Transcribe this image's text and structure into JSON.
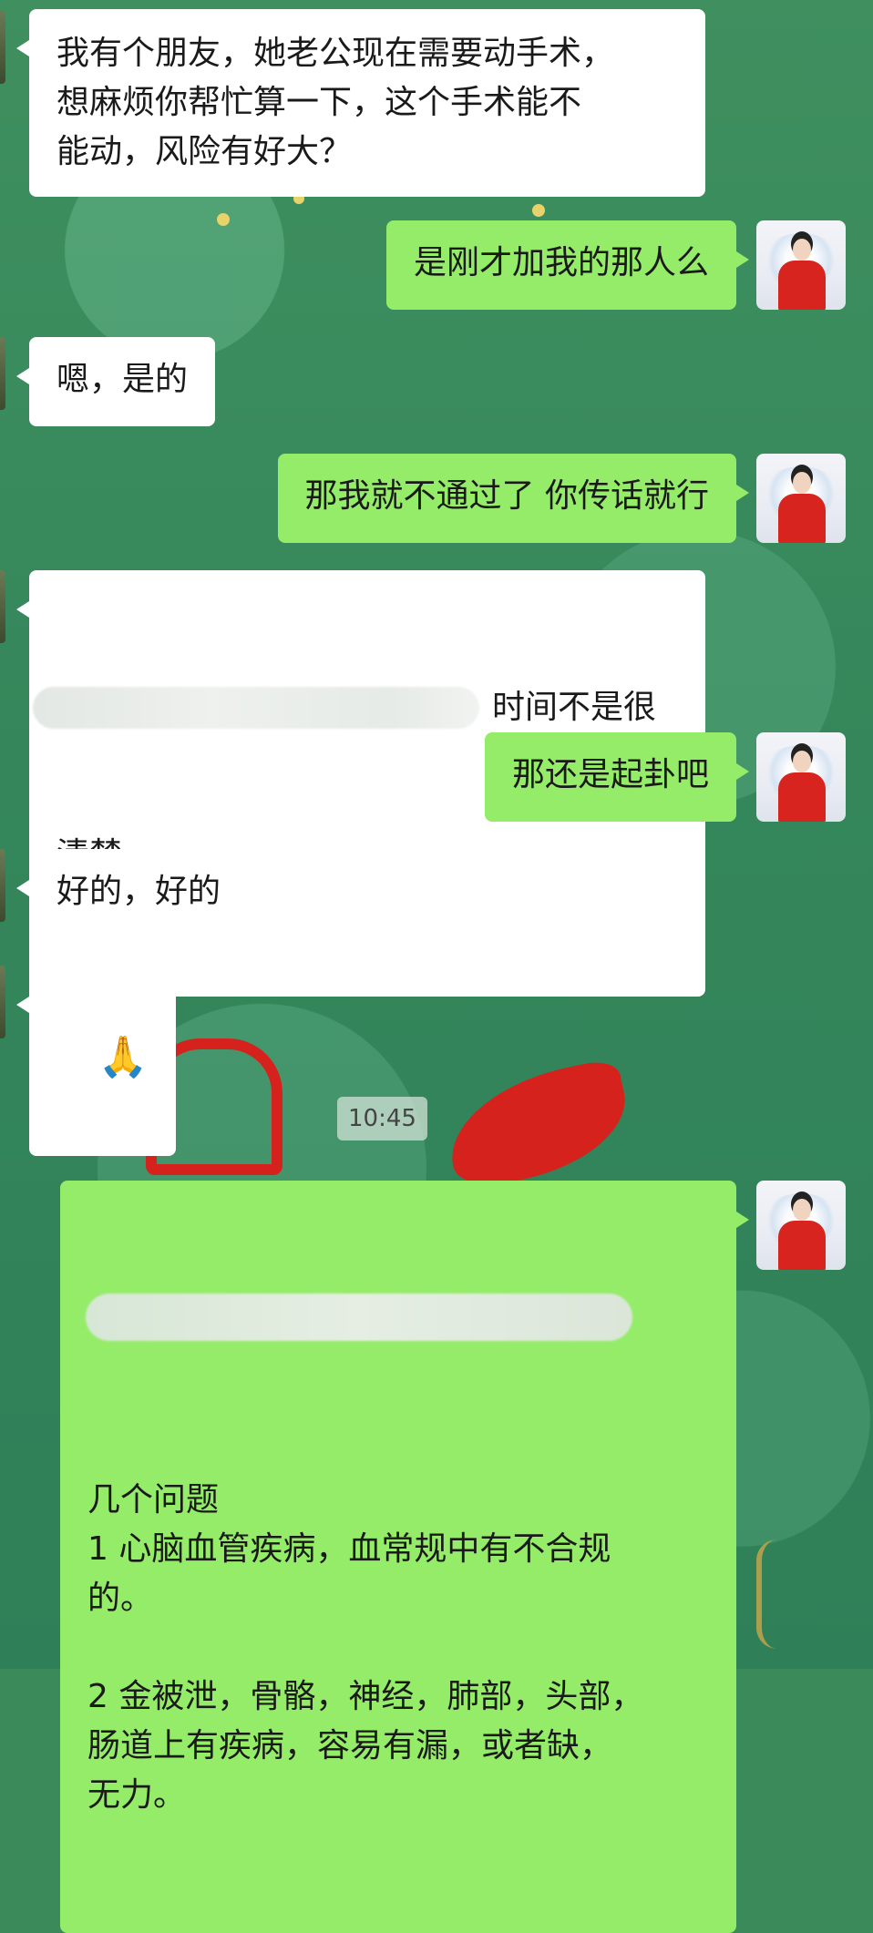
{
  "messages": [
    {
      "side": "left",
      "text": "我有个朋友，她老公现在需要动手术，\n想麻烦你帮忙算一下，这个手术能不\n能动，风险有好大？"
    },
    {
      "side": "right",
      "text": "是刚才加我的那人么"
    },
    {
      "side": "left",
      "text": "嗯，是的"
    },
    {
      "side": "right",
      "text": "那我就不通过了 你传话就行"
    },
    {
      "side": "left",
      "text_visible_1": "时间不是很",
      "text_visible_2": "清楚",
      "redacted": true
    },
    {
      "side": "right",
      "text": "那还是起卦吧"
    },
    {
      "side": "left",
      "text": "好的，好的"
    },
    {
      "side": "left",
      "emoji": "🙏"
    },
    {
      "side": "right",
      "redacted_header": true,
      "text": "几个问题\n1 心脑血管疾病，血常规中有不合规\n的。\n\n2 金被泄，骨骼，神经，肺部，头部，\n肠道上有疾病，容易有漏，或者缺，\n无力。"
    }
  ],
  "timestamp": "10:45",
  "icons": {
    "avatar": "user-avatar-icon",
    "emoji": "praying-hands-icon"
  },
  "colors": {
    "green_bubble": "#95ec69",
    "white_bubble": "#ffffff",
    "background": "#3a8a5a"
  }
}
